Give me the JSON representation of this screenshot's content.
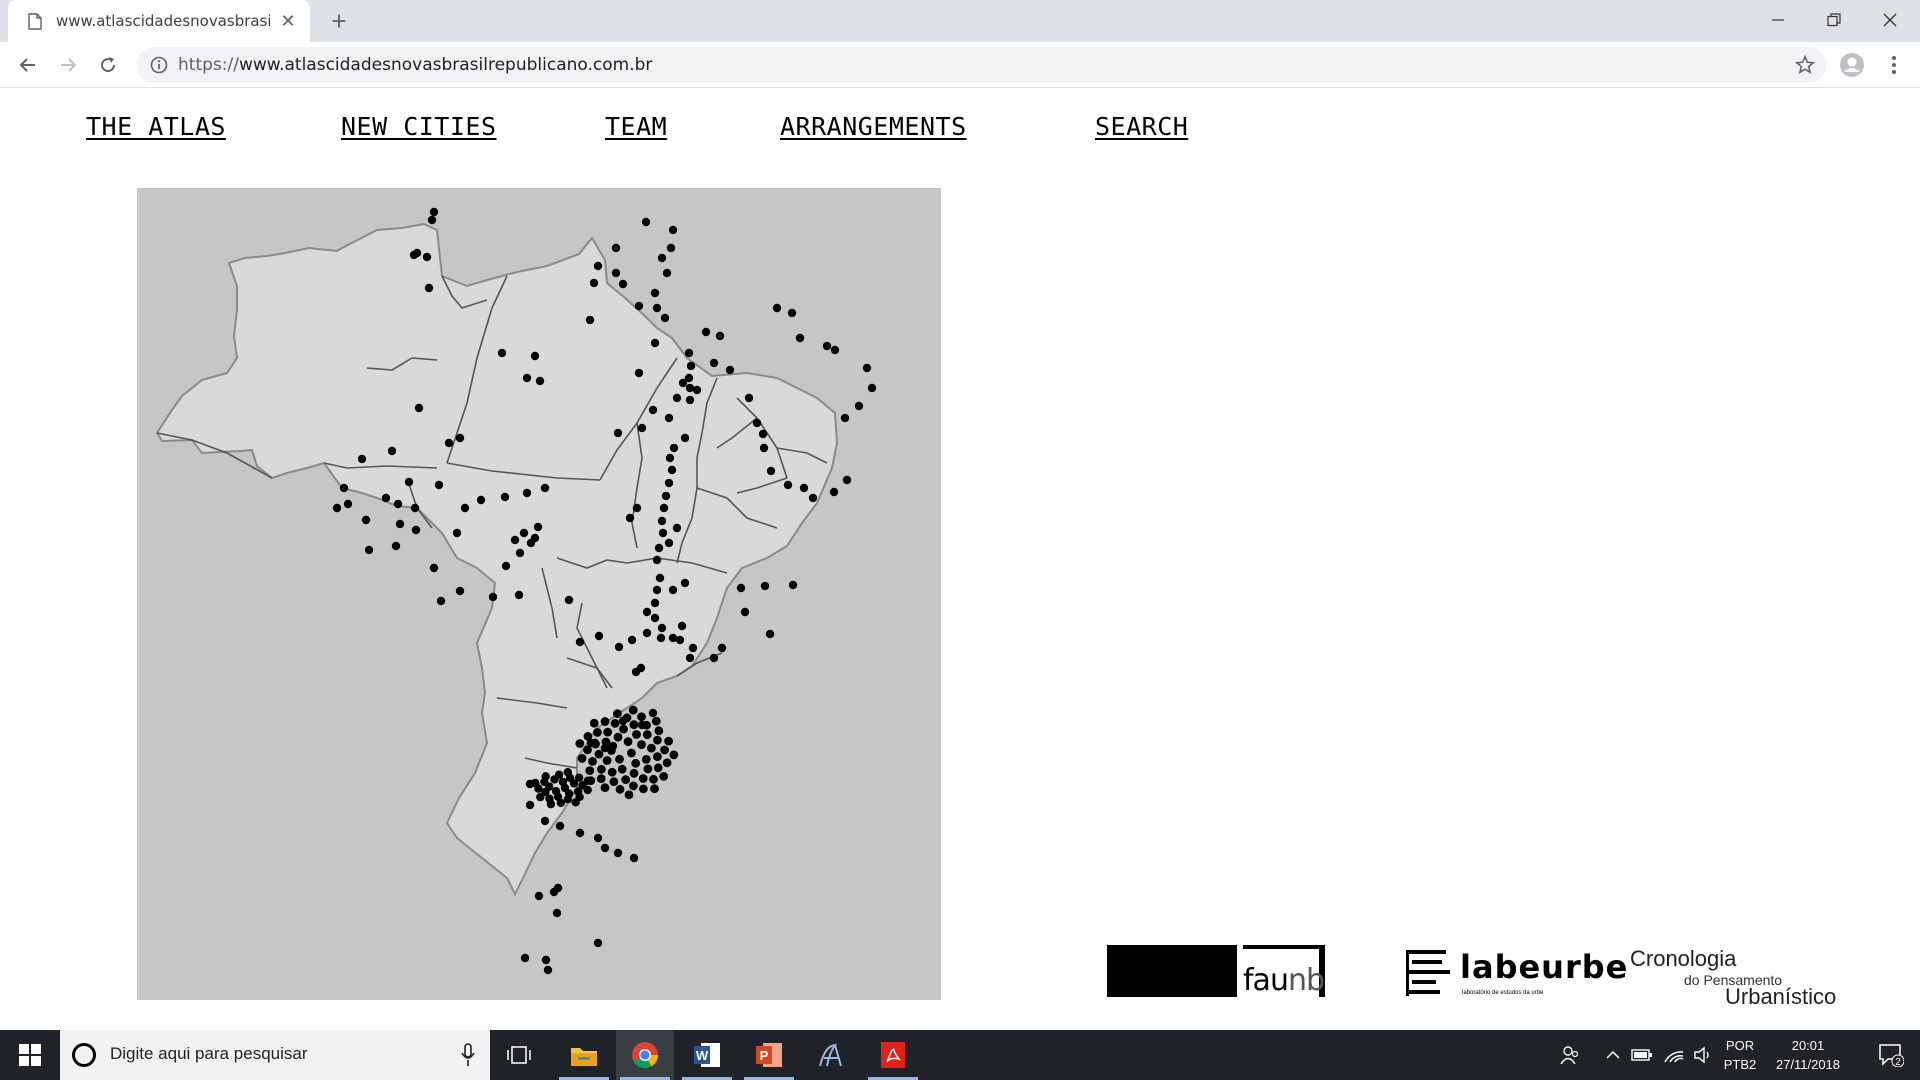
{
  "browser": {
    "tab_title": "www.atlascidadesnovasbrasilrepublicano.com.br",
    "url_scheme": "https://",
    "url_rest": "www.atlascidadesnovasbrasilrepublicano.com.br"
  },
  "nav": {
    "atlas": "THE ATLAS",
    "cities": "NEW CITIES",
    "team": "TEAM",
    "arrangements": "ARRANGEMENTS",
    "search": "SEARCH"
  },
  "logos": {
    "faunb_fau": "fau",
    "faunb_nb": "nb",
    "labeurbe": "labeurbe",
    "labeurbe_sub": "laboratório de estudos da urbe",
    "crono_1": "Cronologia",
    "crono_2": "do Pensamento",
    "crono_3": "Urbanístico"
  },
  "taskbar": {
    "search_placeholder": "Digite aqui para pesquisar",
    "lang_1": "POR",
    "lang_2": "PTB2",
    "time": "20:01",
    "date": "27/11/2018",
    "notifications": "2"
  },
  "colors": {
    "map_bg": "#c6c6c6",
    "land": "#d9d9d9",
    "dots": "#000000",
    "taskbar": "#1f2226"
  },
  "icons": [
    "page-icon",
    "close-icon",
    "plus-icon",
    "minimize-icon",
    "maximize-icon",
    "back-icon",
    "forward-icon",
    "reload-icon",
    "info-icon",
    "star-icon",
    "profile-icon",
    "menu-icon",
    "windows-icon",
    "cortana-icon",
    "mic-icon",
    "task-view-icon",
    "file-explorer-icon",
    "chrome-icon",
    "word-icon",
    "powerpoint-icon",
    "app-a-icon",
    "acrobat-icon",
    "people-icon",
    "chevron-up-icon",
    "battery-icon",
    "wifi-icon",
    "volume-icon",
    "notification-icon"
  ]
}
